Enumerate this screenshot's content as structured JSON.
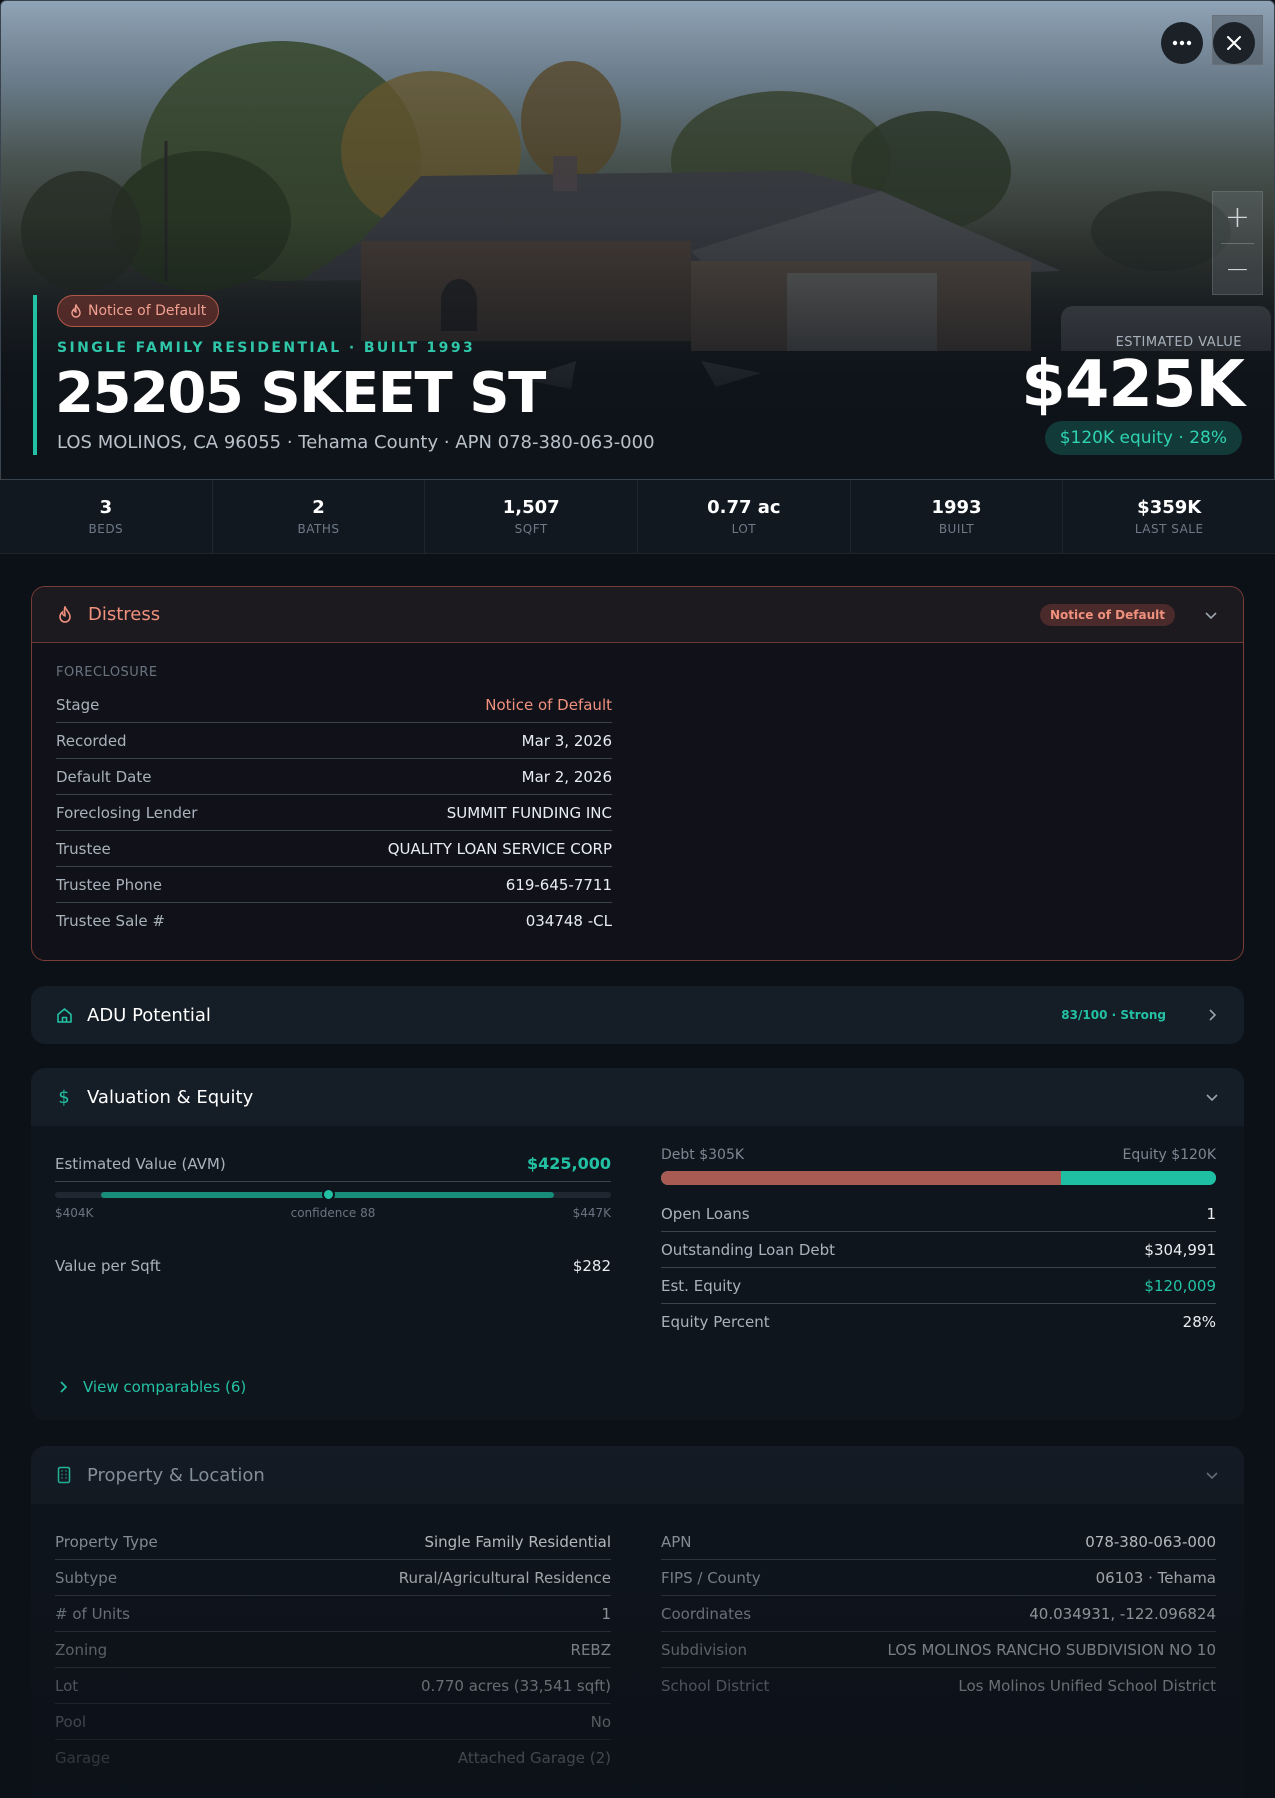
{
  "hero": {
    "status_badge": "Notice of Default",
    "subline": "SINGLE FAMILY RESIDENTIAL · BUILT 1993",
    "address": "25205 SKEET ST",
    "location": "LOS MOLINOS, CA 96055 · Tehama County · APN 078-380-063-000",
    "estimated_value_label": "ESTIMATED VALUE",
    "estimated_value": "$425K",
    "equity_pill": "$120K equity · 28%"
  },
  "stats": [
    {
      "value": "3",
      "label": "BEDS"
    },
    {
      "value": "2",
      "label": "BATHS"
    },
    {
      "value": "1,507",
      "label": "SQFT"
    },
    {
      "value": "0.77 ac",
      "label": "LOT"
    },
    {
      "value": "1993",
      "label": "BUILT"
    },
    {
      "value": "$359K",
      "label": "LAST SALE"
    }
  ],
  "distress": {
    "title": "Distress",
    "badge": "Notice of Default",
    "section_label": "FORECLOSURE",
    "rows": [
      {
        "label": "Stage",
        "value": "Notice of Default"
      },
      {
        "label": "Recorded",
        "value": "Mar 3, 2026"
      },
      {
        "label": "Default Date",
        "value": "Mar 2, 2026"
      },
      {
        "label": "Foreclosing Lender",
        "value": "SUMMIT FUNDING INC"
      },
      {
        "label": "Trustee",
        "value": "QUALITY LOAN SERVICE CORP"
      },
      {
        "label": "Trustee Phone",
        "value": "619-645-7711"
      },
      {
        "label": "Trustee Sale #",
        "value": "034748 -CL"
      }
    ]
  },
  "adu": {
    "title": "ADU Potential",
    "score": "83/100 · Strong"
  },
  "valuation": {
    "title": "Valuation & Equity",
    "avm_label": "Estimated Value (AVM)",
    "avm_value": "$425,000",
    "range_low": "$404K",
    "range_high": "$447K",
    "confidence": "confidence 88",
    "avm_position": 0.5,
    "value_per_sqft_label": "Value per Sqft",
    "value_per_sqft": "$282",
    "debt_label": "Debt $305K",
    "equity_label": "Equity $120K",
    "debt_fraction": 0.72,
    "rows": [
      {
        "label": "Open Loans",
        "value": "1"
      },
      {
        "label": "Outstanding Loan Debt",
        "value": "$304,991"
      },
      {
        "label": "Est. Equity",
        "value": "$120,009"
      },
      {
        "label": "Equity Percent",
        "value": "28%"
      }
    ],
    "comparables_link": "View comparables (6)"
  },
  "property": {
    "title": "Property & Location",
    "left_rows": [
      {
        "label": "Property Type",
        "value": "Single Family Residential"
      },
      {
        "label": "Subtype",
        "value": "Rural/Agricultural Residence"
      },
      {
        "label": "# of Units",
        "value": "1"
      },
      {
        "label": "Zoning",
        "value": "REBZ"
      },
      {
        "label": "Lot",
        "value": "0.770 acres (33,541 sqft)"
      },
      {
        "label": "Pool",
        "value": "No"
      },
      {
        "label": "Garage",
        "value": "Attached Garage (2)"
      }
    ],
    "right_rows": [
      {
        "label": "APN",
        "value": "078-380-063-000"
      },
      {
        "label": "FIPS / County",
        "value": "06103 · Tehama"
      },
      {
        "label": "Coordinates",
        "value": "40.034931, -122.096824"
      },
      {
        "label": "Subdivision",
        "value": "LOS MOLINOS RANCHO SUBDIVISION NO 10"
      },
      {
        "label": "School District",
        "value": "Los Molinos Unified School District"
      }
    ]
  },
  "colors": {
    "accent": "#23c1a4",
    "distress": "#f0917e",
    "debt": "#a85b52",
    "equity": "#1fbfa3"
  }
}
